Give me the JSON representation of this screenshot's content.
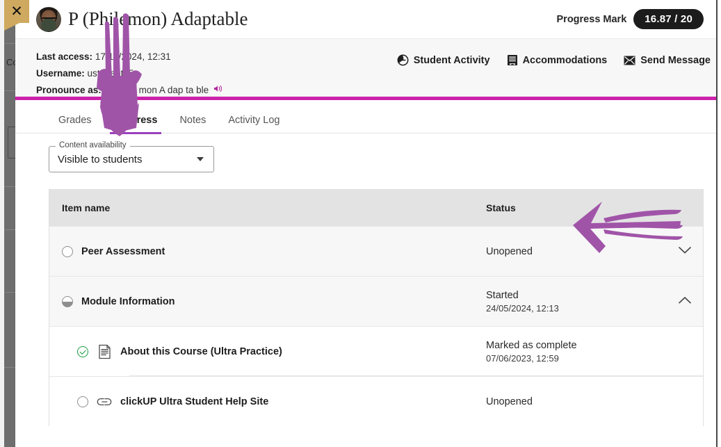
{
  "window": {
    "close_label": "✕",
    "background_label": "Co"
  },
  "header": {
    "student_name": "P (Philemon) Adaptable",
    "avatar_alt": "student-avatar",
    "progress_label": "Progress Mark",
    "progress_value": "16.87 / 20"
  },
  "info": {
    "last_access_label": "Last access:",
    "last_access_value": "17/10/2024, 12:31",
    "username_label": "Username:",
    "username_value": "ustudent35",
    "pronounce_label": "Pronounce as:",
    "pronounce_value": "P Phi le mon A dap ta ble",
    "speaker_icon": "🔊",
    "actions": [
      {
        "label": "Student Activity",
        "icon": "clock-icon"
      },
      {
        "label": "Accommodations",
        "icon": "document-icon"
      },
      {
        "label": "Send Message",
        "icon": "envelope-icon"
      }
    ]
  },
  "tabs": [
    {
      "label": "Grades",
      "active": false
    },
    {
      "label": "Progress",
      "active": true
    },
    {
      "label": "Notes",
      "active": false
    },
    {
      "label": "Activity Log",
      "active": false
    }
  ],
  "filter": {
    "legend": "Content availability",
    "value": "Visible to students"
  },
  "table": {
    "columns": {
      "item": "Item name",
      "status": "Status"
    },
    "rows": [
      {
        "name": "Peer Assessment",
        "status": "Unopened",
        "status_date": "",
        "indicator": "empty-circle",
        "type_icon": "",
        "chevron": "chevron-down-icon",
        "level": "parent"
      },
      {
        "name": "Module Information",
        "status": "Started",
        "status_date": "24/05/2024, 12:13",
        "indicator": "half-circle",
        "type_icon": "",
        "chevron": "chevron-up-icon",
        "level": "parent"
      },
      {
        "name": "About this Course (Ultra Practice)",
        "status": "Marked as complete",
        "status_date": "07/06/2023, 12:59",
        "indicator": "check-circle",
        "type_icon": "document-icon",
        "chevron": "",
        "level": "child"
      },
      {
        "name": "clickUP Ultra Student Help Site",
        "status": "Unopened",
        "status_date": "",
        "indicator": "empty-circle",
        "type_icon": "link-icon",
        "chevron": "",
        "level": "child"
      }
    ]
  },
  "annotations": {
    "down_arrow": "hand-drawn-down-arrow-pointing-to-progress-tab",
    "left_arrow": "hand-drawn-left-arrow-pointing-to-status-column",
    "color": "#a054a8"
  },
  "colors": {
    "accent_magenta": "#cc22ab",
    "tab_active": "#9b3fbf",
    "pill_bg": "#1c1c1c",
    "annotation": "#a054a8",
    "complete_green": "#1a9c3e"
  }
}
